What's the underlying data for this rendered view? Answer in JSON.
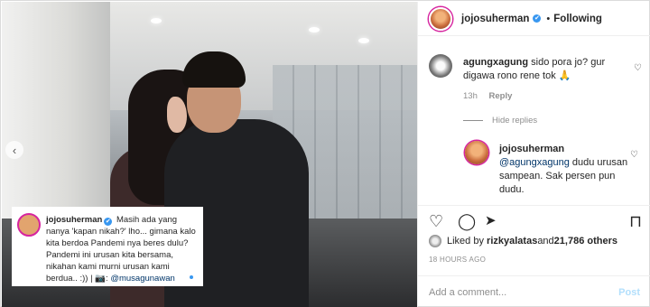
{
  "post": {
    "author": "jojosuherman",
    "separator": "•",
    "follow_state": "Following"
  },
  "caption": {
    "user": "jojosuherman",
    "verified_icon": "✔",
    "text": "Masih ada yang nanya 'kapan nikah?' lho... gimana kalo kita berdoa Pandemi nya beres dulu? Pandemi ini urusan kita bersama, nikahan kami murni urusan kami berdua.. :)) | 📷: ",
    "mention": "@musagunawan"
  },
  "comments": [
    {
      "user": "agungxagung",
      "text": "sido pora jo? gur digawa rono rene tok 🙏",
      "time": "13h",
      "reply_label": "Reply"
    }
  ],
  "hide_replies_label": "Hide replies",
  "replies": [
    {
      "user": "jojosuherman",
      "mention": "@agungxagung",
      "text": " dudu urusan sampean. Sak persen pun dudu."
    }
  ],
  "likes": {
    "prefix": "Liked by ",
    "first_user": "rizkyalatas",
    "middle": " and ",
    "count": "21,786 others"
  },
  "timestamp": "18 HOURS AGO",
  "add_comment": {
    "placeholder": "Add a comment...",
    "post_label": "Post"
  },
  "icons": {
    "heart": "♡",
    "comment": "◯",
    "share": "➤",
    "save": "⊓",
    "prev": "‹"
  },
  "colors": {
    "accent": "#3897f0",
    "story_ring": "#d6249f"
  }
}
